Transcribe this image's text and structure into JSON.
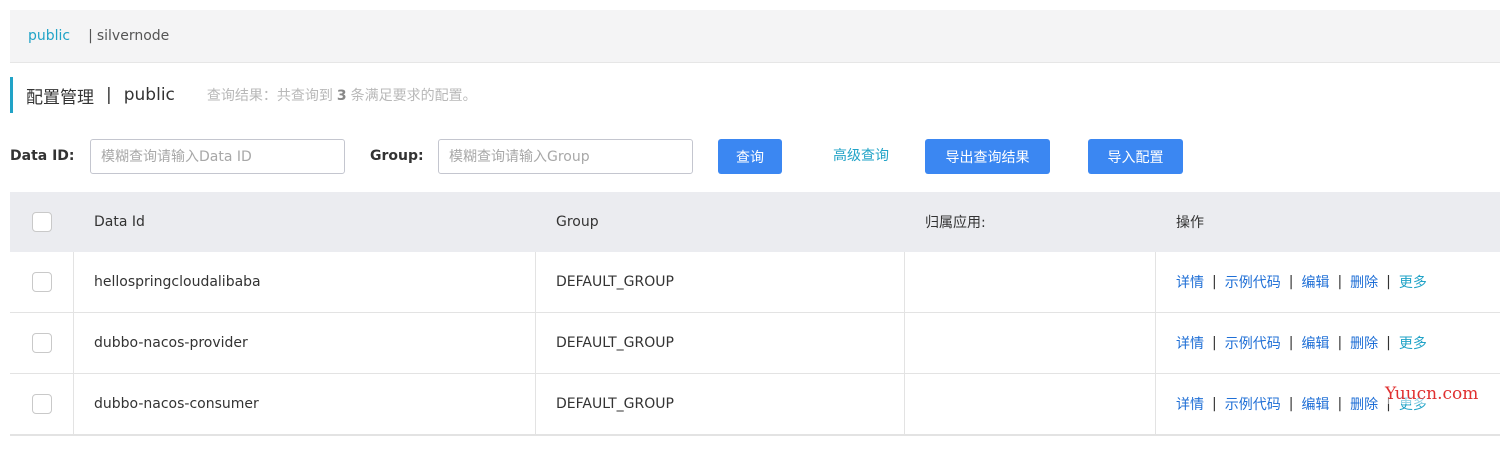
{
  "namespace_bar": {
    "active": "public",
    "separator": "|",
    "items": [
      "silvernode"
    ]
  },
  "header": {
    "title": "配置管理",
    "divider": "|",
    "namespace": "public",
    "result_prefix": "查询结果：共查询到",
    "result_count": "3",
    "result_suffix": "条满足要求的配置。"
  },
  "filters": {
    "data_id_label": "Data ID:",
    "data_id_placeholder": "模糊查询请输入Data ID",
    "group_label": "Group:",
    "group_placeholder": "模糊查询请输入Group",
    "query_button": "查询",
    "advanced_link": "高级查询",
    "export_button": "导出查询结果",
    "import_button": "导入配置"
  },
  "table": {
    "columns": [
      "Data Id",
      "Group",
      "归属应用:",
      "操作"
    ],
    "rows": [
      {
        "data_id": "hellospringcloudalibaba",
        "group": "DEFAULT_GROUP",
        "app": ""
      },
      {
        "data_id": "dubbo-nacos-provider",
        "group": "DEFAULT_GROUP",
        "app": ""
      },
      {
        "data_id": "dubbo-nacos-consumer",
        "group": "DEFAULT_GROUP",
        "app": ""
      }
    ],
    "actions": {
      "detail": "详情",
      "sample_code": "示例代码",
      "edit": "编辑",
      "delete": "删除",
      "more": "更多",
      "separator": "|"
    }
  },
  "watermark": "Yuucn.com",
  "colors": {
    "accent": "#21a3c7",
    "primary_button": "#3b87f2",
    "link": "#1f6fd6"
  }
}
